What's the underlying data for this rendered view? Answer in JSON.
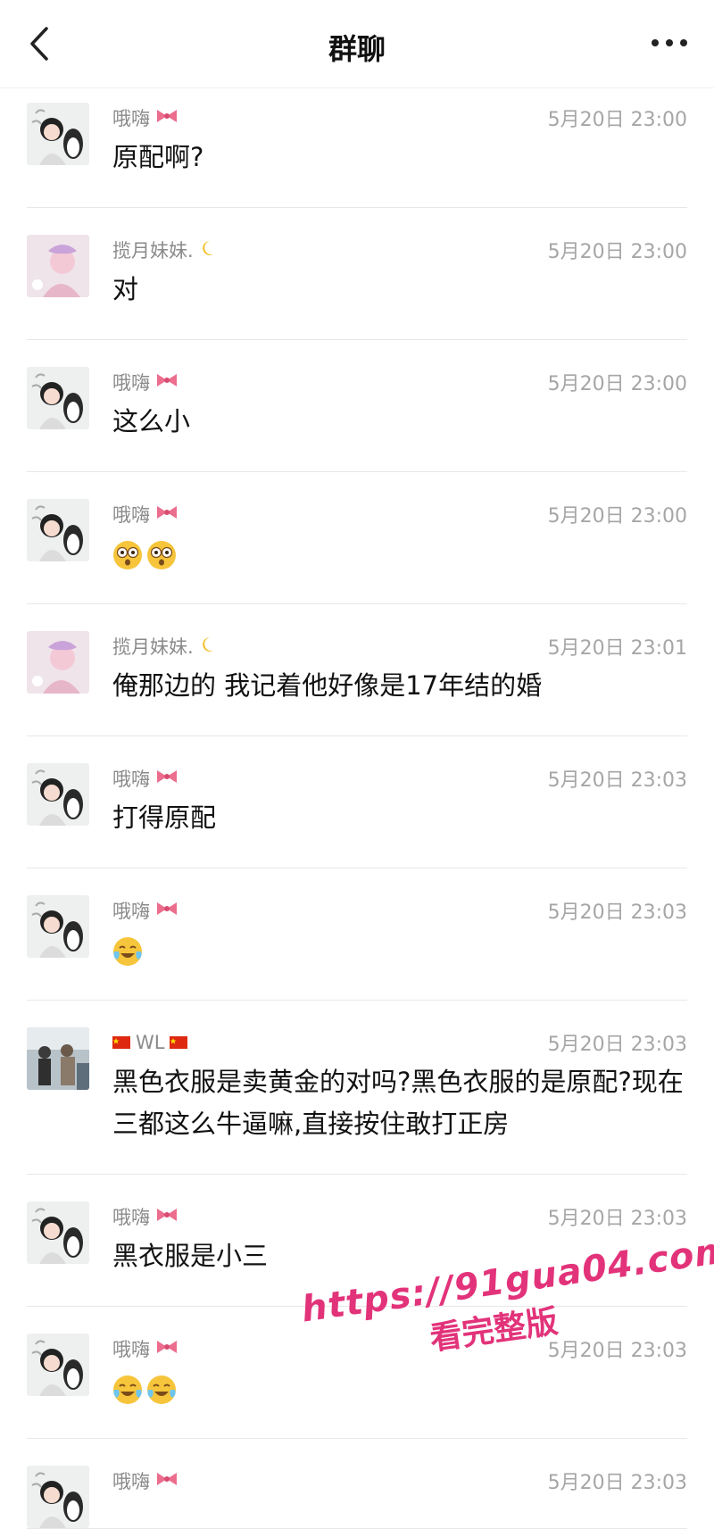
{
  "header": {
    "title": "群聊"
  },
  "messages": [
    {
      "author": "哦嗨",
      "badge": "bow",
      "time": "5月20日 23:00",
      "text": "原配啊?",
      "avatar": "girl"
    },
    {
      "author": "揽月妹妹.",
      "badge": "moon",
      "time": "5月20日 23:00",
      "text": "对",
      "avatar": "pink"
    },
    {
      "author": "哦嗨",
      "badge": "bow",
      "time": "5月20日 23:00",
      "text": "这么小",
      "avatar": "girl"
    },
    {
      "author": "哦嗨",
      "badge": "bow",
      "time": "5月20日 23:00",
      "text": "",
      "emojis": [
        "shocked",
        "shocked"
      ],
      "avatar": "girl"
    },
    {
      "author": "揽月妹妹.",
      "badge": "moon",
      "time": "5月20日 23:01",
      "text": "俺那边的 我记着他好像是17年结的婚",
      "avatar": "pink"
    },
    {
      "author": "哦嗨",
      "badge": "bow",
      "time": "5月20日 23:03",
      "text": "打得原配",
      "avatar": "girl"
    },
    {
      "author": "哦嗨",
      "badge": "bow",
      "time": "5月20日 23:03",
      "text": "",
      "emojis": [
        "laugh-cry"
      ],
      "avatar": "girl"
    },
    {
      "author": "WL",
      "badge": "flags",
      "time": "5月20日 23:03",
      "text": "黑色衣服是卖黄金的对吗?黑色衣服的是原配?现在三都这么牛逼嘛,直接按住敢打正房",
      "avatar": "group"
    },
    {
      "author": "哦嗨",
      "badge": "bow",
      "time": "5月20日 23:03",
      "text": "黑衣服是小三",
      "avatar": "girl"
    },
    {
      "author": "哦嗨",
      "badge": "bow",
      "time": "5月20日 23:03",
      "text": "",
      "emojis": [
        "laugh-cry",
        "laugh-cry"
      ],
      "avatar": "girl"
    },
    {
      "author": "哦嗨",
      "badge": "bow",
      "time": "5月20日 23:03",
      "text": "",
      "avatar": "girl"
    }
  ],
  "watermark": {
    "url": "https://91gua04.com",
    "subtitle": "看完整版"
  },
  "colors": {
    "accent": "#e2337a",
    "meta": "#8a8a8a"
  }
}
